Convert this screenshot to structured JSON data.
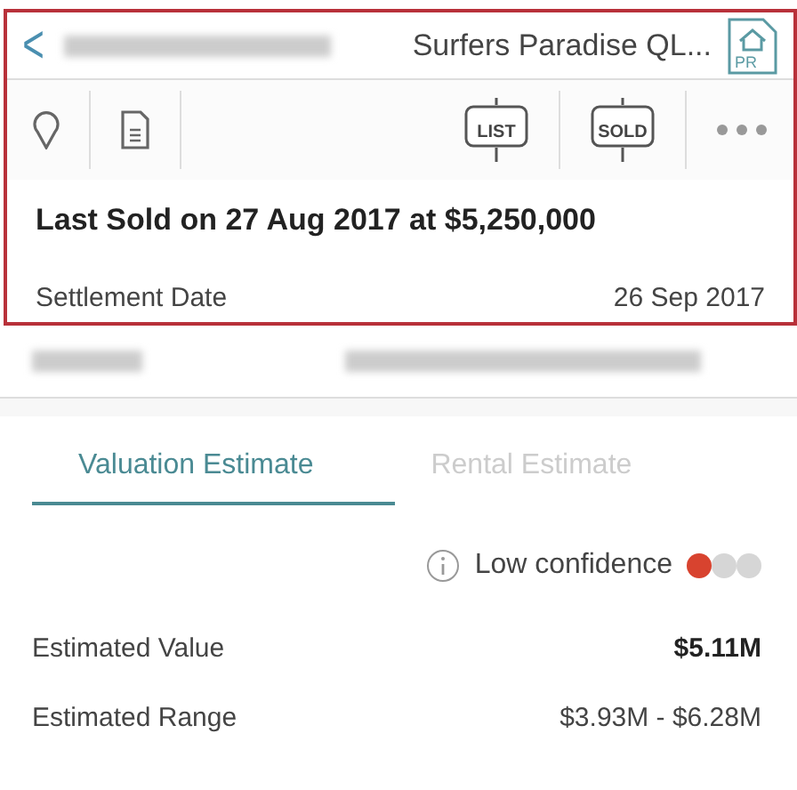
{
  "header": {
    "back": "<",
    "title": "Surfers Paradise QL...",
    "badge": "PR"
  },
  "toolbar": {
    "actions": [
      {
        "kind": "pin"
      },
      {
        "kind": "document"
      },
      {
        "kind": "tag",
        "label": "LIST"
      },
      {
        "kind": "tag",
        "label": "SOLD"
      },
      {
        "kind": "more"
      }
    ]
  },
  "headline": "Last Sold on 27 Aug 2017 at $5,250,000",
  "details": [
    {
      "label": "Settlement Date",
      "value": "26 Sep 2017"
    }
  ],
  "tabs": [
    {
      "label": "Valuation Estimate",
      "selected": true
    },
    {
      "label": "Rental Estimate",
      "selected": false
    }
  ],
  "confidence": {
    "text": "Low confidence",
    "dots": [
      {
        "color": "#d8432f"
      },
      {
        "color": "#d6d6d6"
      },
      {
        "color": "#d6d6d6"
      }
    ]
  },
  "estimates": [
    {
      "label": "Estimated Value",
      "value": "$5.11M",
      "emphasis": true
    },
    {
      "label": "Estimated Range",
      "value": "$3.93M - $6.28M",
      "emphasis": false
    }
  ]
}
